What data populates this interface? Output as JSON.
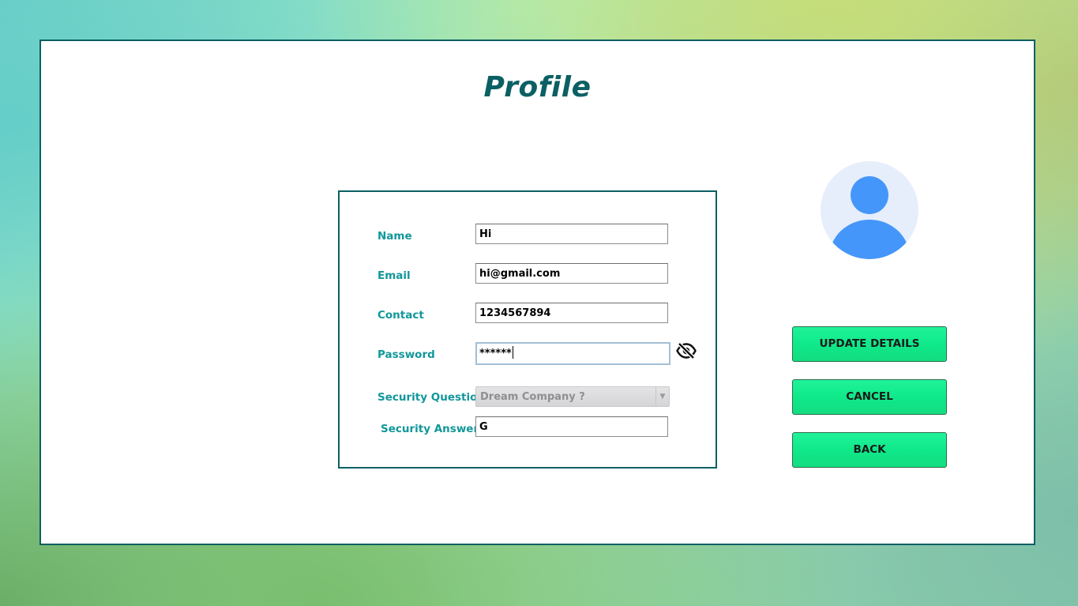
{
  "page": {
    "title": "Profile"
  },
  "form": {
    "name": {
      "label": "Name",
      "value": "Hi"
    },
    "email": {
      "label": "Email",
      "value": "hi@gmail.com"
    },
    "contact": {
      "label": "Contact",
      "value": "1234567894"
    },
    "password": {
      "label": "Password",
      "value": "******",
      "toggle_icon": "eye-off-icon"
    },
    "security_question": {
      "label": "Security Question",
      "selected": "Dream Company ?"
    },
    "security_answer": {
      "label": "Security Answer",
      "value": "G"
    }
  },
  "actions": {
    "update_label": "UPDATE DETAILS",
    "cancel_label": "CANCEL",
    "back_label": "BACK"
  },
  "colors": {
    "accent_teal": "#0b6063",
    "label_teal": "#11979a",
    "button_green": "#13e98a",
    "avatar_blue": "#4596fa",
    "avatar_bg": "#e6eefc"
  }
}
